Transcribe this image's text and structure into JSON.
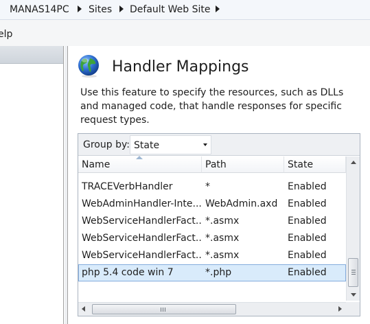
{
  "breadcrumb": {
    "items": [
      "MANAS14PC",
      "Sites",
      "Default Web Site"
    ]
  },
  "menu": {
    "items": [
      "elp"
    ]
  },
  "feature": {
    "title": "Handler Mappings",
    "description": "Use this feature to specify the resources, such as DLLs and managed code, that handle responses for specific request types."
  },
  "group_by": {
    "label": "Group by:",
    "value": "State"
  },
  "table": {
    "columns": [
      "Name",
      "Path",
      "State"
    ],
    "rows": [
      {
        "name": "TRACEVerbHandler",
        "path": "*",
        "state": "Enabled"
      },
      {
        "name": "WebAdminHandler-Inte...",
        "path": "WebAdmin.axd",
        "state": "Enabled"
      },
      {
        "name": "WebServiceHandlerFact...",
        "path": "*.asmx",
        "state": "Enabled"
      },
      {
        "name": "WebServiceHandlerFact...",
        "path": "*.asmx",
        "state": "Enabled"
      },
      {
        "name": "WebServiceHandlerFact...",
        "path": "*.asmx",
        "state": "Enabled"
      },
      {
        "name": "php 5.4 code win 7",
        "path": "*.php",
        "state": "Enabled"
      }
    ],
    "selected_row": "php 5.4 code win 7"
  },
  "colors": {
    "selection_bg": "#d9ebfb",
    "selection_border": "#84acdd",
    "globe_blue": "#2f6fd0",
    "globe_green": "#3da33a"
  },
  "icons": {
    "feature_icon": "globe-icon",
    "breadcrumb_separator": "triangle-right-icon",
    "dropdown_caret": "chevron-down-icon"
  }
}
